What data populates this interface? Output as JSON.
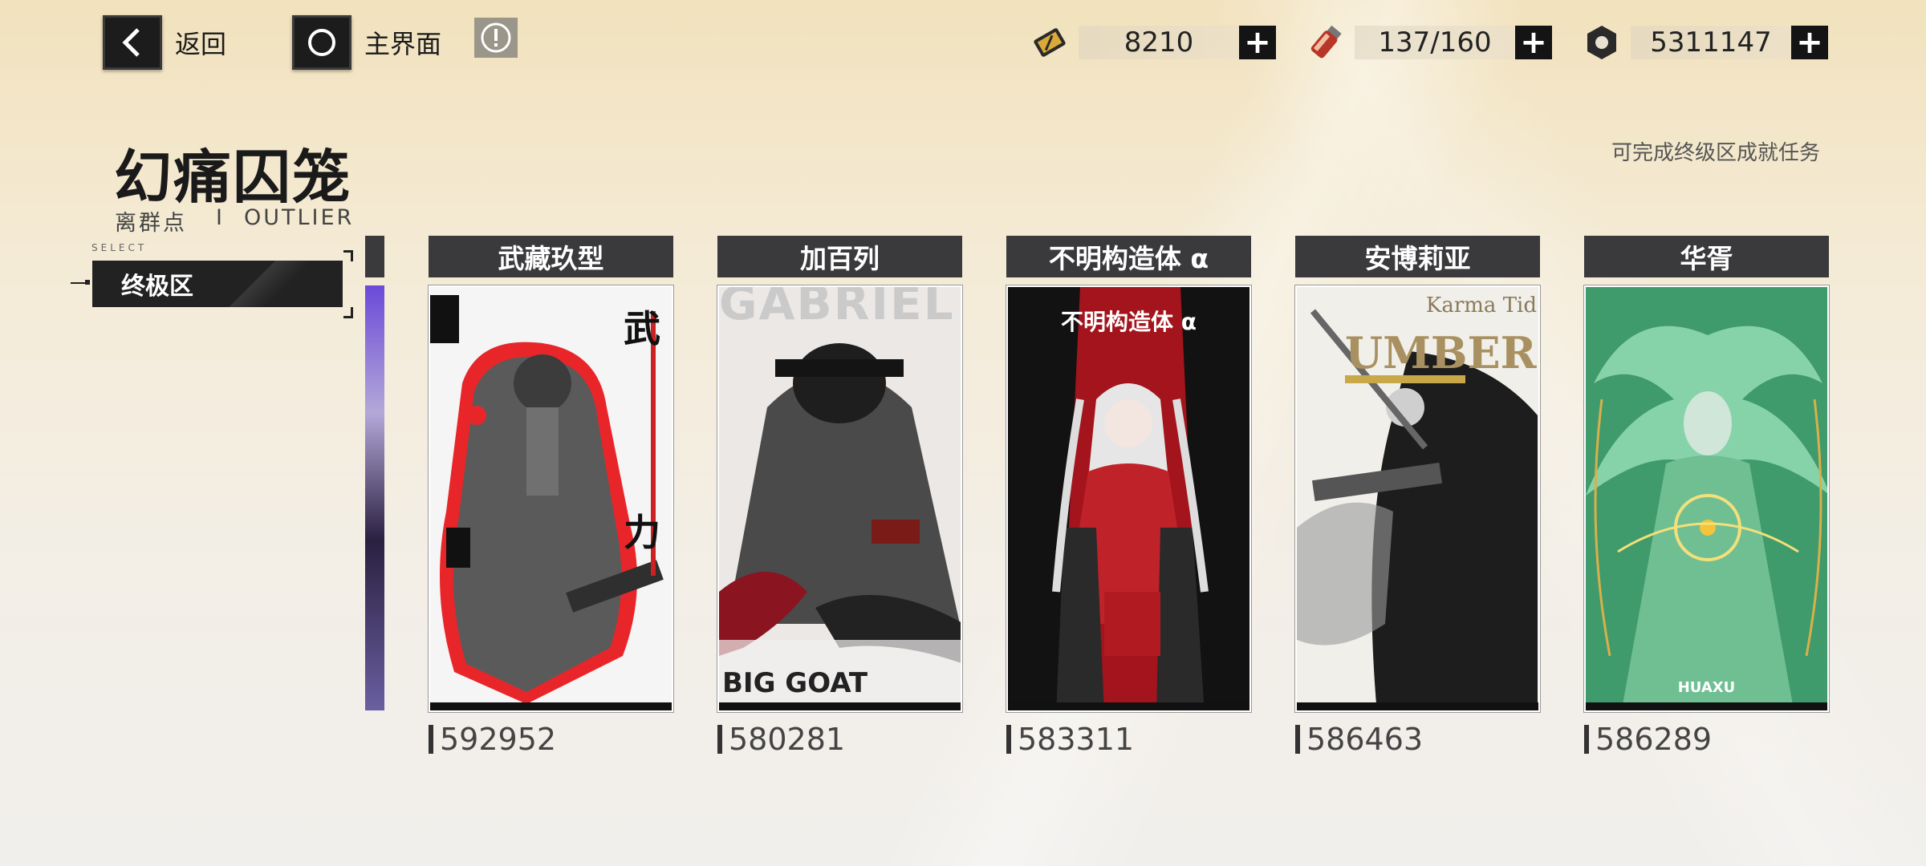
{
  "nav": {
    "back_label": "返回",
    "home_label": "主界面",
    "info_icon": "exclamation-icon"
  },
  "resources": [
    {
      "icon": "ticket-icon",
      "value": "8210"
    },
    {
      "icon": "stamina-vial-icon",
      "value": "137/160"
    },
    {
      "icon": "gear-coin-icon",
      "value": "5311147"
    }
  ],
  "plus_label": "+",
  "page": {
    "title": "幻痛囚笼",
    "subtitle_cn": "离群点",
    "subtitle_sep": "I",
    "subtitle_en": "OUTLIER",
    "hint": "可完成终级区成就任务"
  },
  "selector": {
    "tag": "SELECT",
    "active_tab": "终极区"
  },
  "cards": [
    {
      "name": "武藏玖型",
      "score": "592952"
    },
    {
      "name": "加百列",
      "score": "580281"
    },
    {
      "name": "不明构造体 α",
      "score": "583311"
    },
    {
      "name": "安博莉亚",
      "score": "586463"
    },
    {
      "name": "华胥",
      "score": "586289"
    }
  ],
  "card_art_text": {
    "c1_side": "武",
    "c1_side2": "力",
    "c2_top": "GABRIEL",
    "c2_bottom": "BIG GOAT",
    "c3_title": "不明构造体 α",
    "c4_top": "Karma Tid",
    "c4_big": "UMBER",
    "c5_bottom": "HUAXU"
  }
}
